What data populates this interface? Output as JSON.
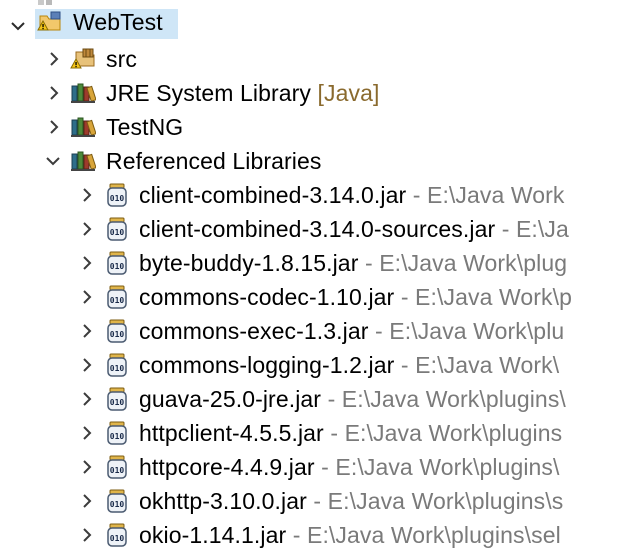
{
  "tree": {
    "project": {
      "label": "WebTest",
      "icon": "project-folder-warning-icon",
      "expanded": true,
      "selected": true
    },
    "children": [
      {
        "label": "src",
        "decoration": "",
        "icon": "package-folder-warning-icon",
        "expanded": false
      },
      {
        "label": "JRE System Library",
        "decoration": "[Java]",
        "icon": "library-icon",
        "expanded": false
      },
      {
        "label": "TestNG",
        "decoration": "",
        "icon": "library-icon",
        "expanded": false
      },
      {
        "label": "Referenced Libraries",
        "decoration": "",
        "icon": "library-icon",
        "expanded": true
      }
    ],
    "jars": [
      {
        "label": "client-combined-3.14.0.jar",
        "path": "- E:\\Java Work"
      },
      {
        "label": "client-combined-3.14.0-sources.jar",
        "path": "- E:\\Ja"
      },
      {
        "label": "byte-buddy-1.8.15.jar",
        "path": "- E:\\Java Work\\plug"
      },
      {
        "label": "commons-codec-1.10.jar",
        "path": "- E:\\Java Work\\p"
      },
      {
        "label": "commons-exec-1.3.jar",
        "path": "- E:\\Java Work\\plu"
      },
      {
        "label": "commons-logging-1.2.jar",
        "path": "- E:\\Java Work\\"
      },
      {
        "label": "guava-25.0-jre.jar",
        "path": "- E:\\Java Work\\plugins\\"
      },
      {
        "label": "httpclient-4.5.5.jar",
        "path": "- E:\\Java Work\\plugins"
      },
      {
        "label": "httpcore-4.4.9.jar",
        "path": "- E:\\Java Work\\plugins\\"
      },
      {
        "label": "okhttp-3.10.0.jar",
        "path": "- E:\\Java Work\\plugins\\s"
      },
      {
        "label": "okio-1.14.1.jar",
        "path": "- E:\\Java Work\\plugins\\sel"
      }
    ]
  },
  "colors": {
    "selection": "#cfe6f7",
    "decoration": "#8a6a2e",
    "jar_path": "#7a7a7a",
    "chevron": "#3c3c3c"
  },
  "icons": {
    "chevron_right": "chevron-right-icon",
    "chevron_down": "chevron-down-icon",
    "jar": "jar-icon"
  }
}
